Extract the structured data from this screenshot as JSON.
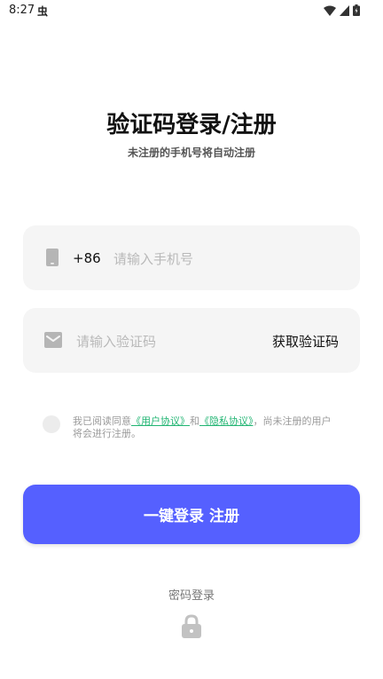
{
  "status_bar": {
    "time": "8:27",
    "notif_glyph": "虫"
  },
  "header": {
    "title": "验证码登录/注册",
    "subtitle": "未注册的手机号将自动注册"
  },
  "phone_field": {
    "icon": "phone-icon",
    "country_code": "+86",
    "placeholder": "请输入手机号",
    "value": ""
  },
  "code_field": {
    "icon": "mail-icon",
    "placeholder": "请输入验证码",
    "value": "",
    "get_code_label": "获取验证码"
  },
  "agreement": {
    "prefix": "我已阅读同意",
    "user_agreement": "《用户协议》",
    "and": "和",
    "privacy_agreement": "《隐私协议》",
    "suffix": "，尚未注册的用户将会进行注册。",
    "link_color": "#22b573",
    "checked": false
  },
  "login_button": {
    "label": "一键登录 注册",
    "color": "#5560ff"
  },
  "password_login": {
    "label": "密码登录",
    "icon": "lock-icon"
  }
}
